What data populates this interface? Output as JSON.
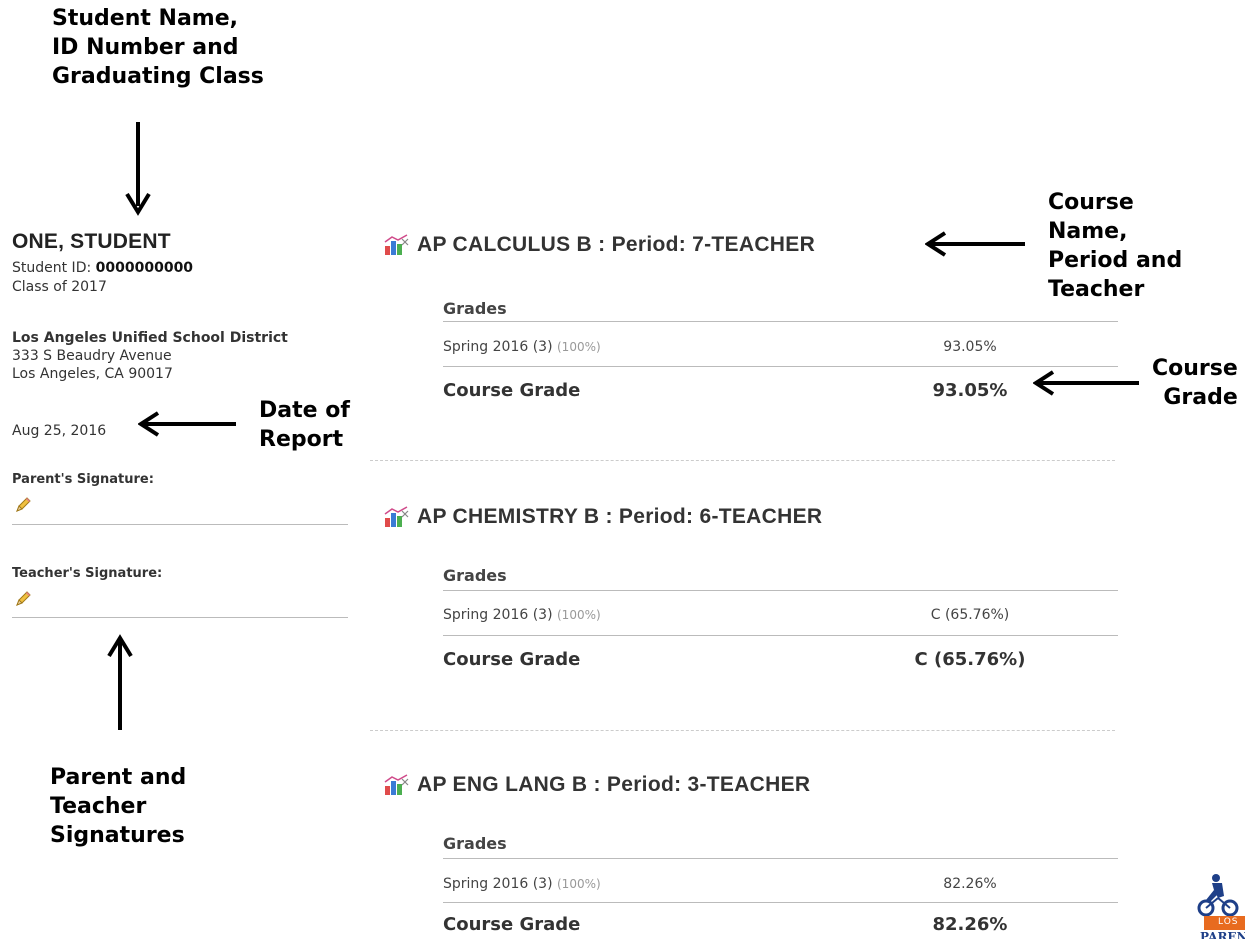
{
  "callouts": {
    "student": "Student Name,\nID Number and\nGraduating Class",
    "date": "Date of\nReport",
    "course_name": "Course\nName,\nPeriod and\nTeacher",
    "course_grade": "Course\nGrade",
    "signatures": "Parent and\nTeacher\nSignatures"
  },
  "student": {
    "name": "ONE, STUDENT",
    "id_label": "Student ID: ",
    "id_value": "0000000000",
    "class": "Class of 2017"
  },
  "school": {
    "name": "Los Angeles Unified School District",
    "address1": "333 S Beaudry Avenue",
    "address2": "Los Angeles, CA 90017"
  },
  "report_date": "Aug 25, 2016",
  "signatures": {
    "parent_label": "Parent's Signature:",
    "teacher_label": "Teacher's Signature:"
  },
  "grades_header": "Grades",
  "course_grade_label": "Course Grade",
  "courses": [
    {
      "title": "AP CALCULUS B : Period: 7-TEACHER",
      "term": "Spring 2016 (3)",
      "weight": "(100%)",
      "term_grade": "93.05%",
      "course_grade": "93.05%"
    },
    {
      "title": "AP CHEMISTRY B : Period: 6-TEACHER",
      "term": "Spring 2016 (3)",
      "weight": "(100%)",
      "term_grade": "C (65.76%)",
      "course_grade": "C (65.76%)"
    },
    {
      "title": "AP ENG LANG B : Period: 3-TEACHER",
      "term": "Spring 2016 (3)",
      "weight": "(100%)",
      "term_grade": "82.26%",
      "course_grade": "82.26%"
    }
  ],
  "logo": {
    "text_top": "LOS",
    "text_bottom": "PARENT"
  },
  "icons": {
    "course": "chart-icon",
    "signature": "pencil-icon"
  }
}
